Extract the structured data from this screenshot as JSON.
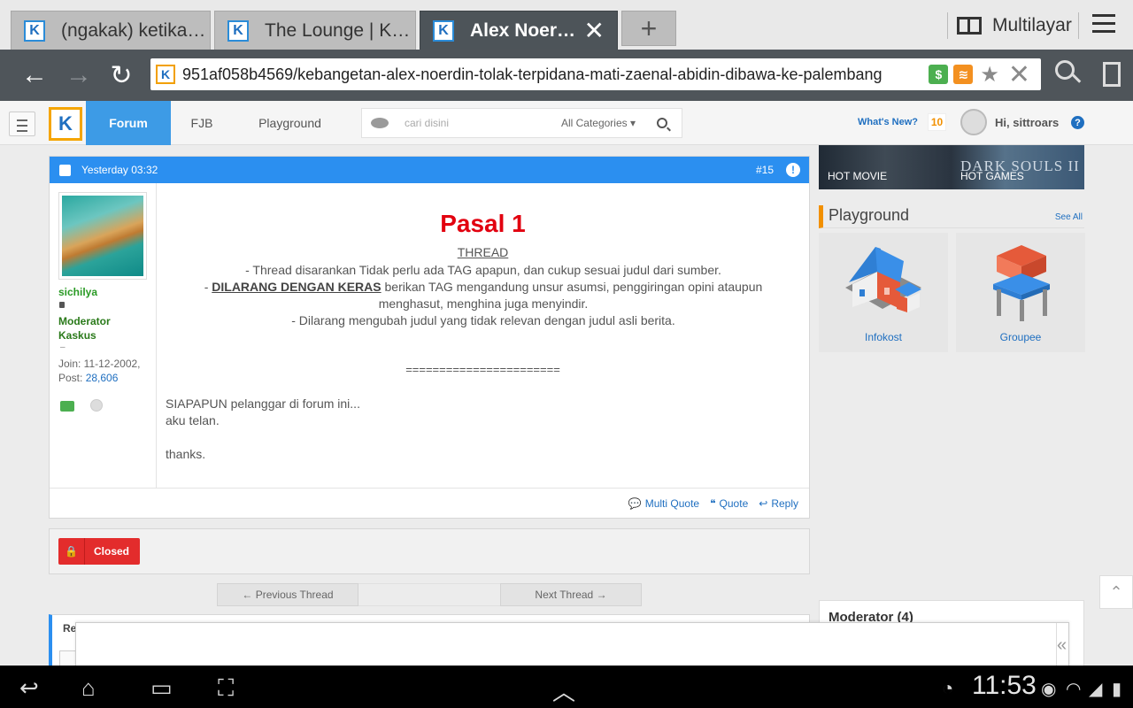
{
  "browser": {
    "tabs": [
      {
        "title": "(ngakak) ketika k...",
        "active": false
      },
      {
        "title": "The Lounge | Kas...",
        "active": false
      },
      {
        "title": "Alex Noerdi...",
        "active": true
      }
    ],
    "new_tab": "+",
    "multi_window_label": "Multilayar",
    "url": "951af058b4569/kebangetan-alex-noerdin-tolak-terpidana-mati-zaenal-abidin-dibawa-ke-palembang"
  },
  "kaskus": {
    "logo": "K",
    "nav": [
      {
        "label": "Forum",
        "active": true
      },
      {
        "label": "FJB",
        "active": false
      },
      {
        "label": "Playground",
        "active": false
      }
    ],
    "search": {
      "placeholder": "cari disini",
      "category": "All Categories"
    },
    "whats_new": "What's New?",
    "notif_count": "10",
    "greeting": "Hi, sittroars",
    "help": "?"
  },
  "post": {
    "date": "Yesterday 03:32",
    "number": "#15",
    "warn": "!",
    "user": {
      "name": "sichilya",
      "role": "Moderator Kaskus",
      "tilde": "–",
      "join_label": "Join: 11-12-2002,",
      "post_label": "Post:",
      "post_count": "28,606"
    },
    "heading": "Pasal 1",
    "subheading": "THREAD",
    "rules": {
      "line1": "- Thread disarankan Tidak perlu ada TAG apapun, dan cukup sesuai judul dari sumber.",
      "line2_prefix": "- ",
      "line2_emph": "DILARANG DENGAN KERAS",
      "line2_rest": " berikan TAG mengandung unsur asumsi, penggiringan opini ataupun menghasut, menghina juga menyindir.",
      "line3": "- Dilarang mengubah judul yang tidak relevan dengan judul asli berita."
    },
    "separator": "=======================",
    "message": {
      "line1": "SIAPAPUN pelanggar di forum ini...",
      "line2": "aku telan.",
      "line3": "thanks."
    },
    "actions": {
      "multi_quote": "Multi Quote",
      "quote": "Quote",
      "reply": "Reply"
    }
  },
  "thread_status": "Closed",
  "pager": {
    "prev": "← Previous Thread",
    "next": "Next Thread →"
  },
  "related_title": "Re",
  "sidebar": {
    "banner_left": "HOT MOVIE",
    "banner_right": "HOT GAMES",
    "banner_game": "DARK SOULS II",
    "playground_title": "Playground",
    "see_all": "See All",
    "cards": [
      {
        "label": "Infokost",
        "icon": "house-icon"
      },
      {
        "label": "Groupee",
        "icon": "chair-icon"
      }
    ],
    "moderator_title": "Moderator (4)"
  },
  "system": {
    "clock": "11:53"
  },
  "colors": {
    "kaskus_blue": "#2b8ff0",
    "closed_red": "#e32c2c",
    "heading_red": "#e2000f",
    "moderator_green": "#2a9a25"
  }
}
